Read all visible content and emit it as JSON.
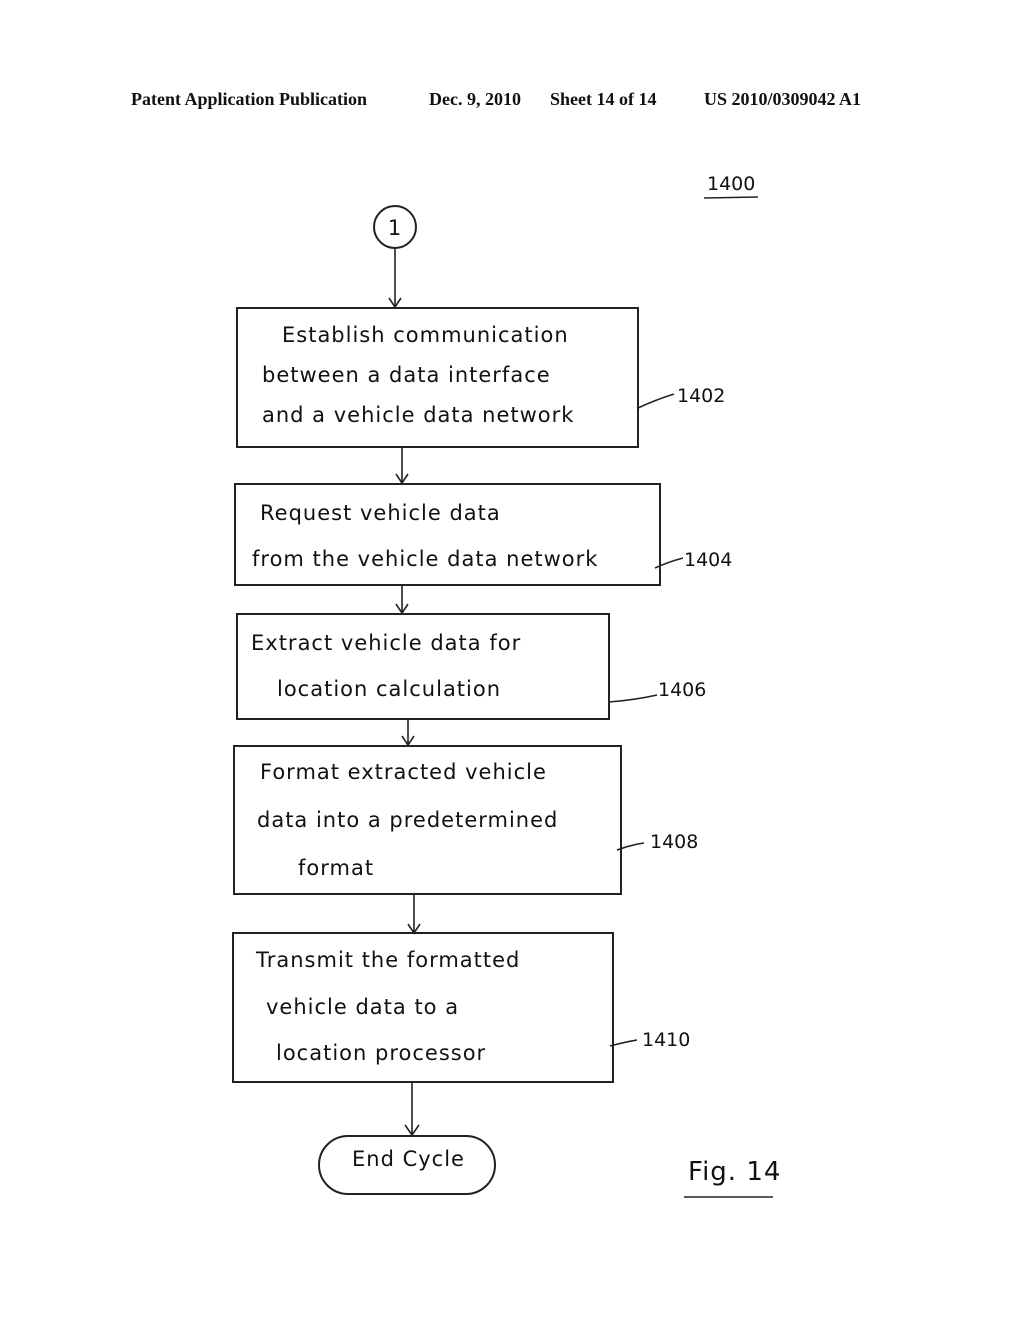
{
  "header": {
    "publication": "Patent Application Publication",
    "date": "Dec. 9, 2010",
    "sheet": "Sheet 14 of 14",
    "number": "US 2010/0309042 A1"
  },
  "figure": {
    "ref": "1400",
    "label": "Fig. 14",
    "connector": "1",
    "steps": [
      {
        "ref": "1402",
        "lines": [
          "Establish communication",
          "between a data interface",
          "and a vehicle data network"
        ]
      },
      {
        "ref": "1404",
        "lines": [
          "Request vehicle data",
          "from the vehicle data network"
        ]
      },
      {
        "ref": "1406",
        "lines": [
          "Extract vehicle data for",
          "location calculation"
        ]
      },
      {
        "ref": "1408",
        "lines": [
          "Format extracted vehicle",
          "data into a predetermined",
          "format"
        ]
      },
      {
        "ref": "1410",
        "lines": [
          "Transmit the formatted",
          "vehicle data to a",
          "location processor"
        ]
      }
    ],
    "end": "End Cycle"
  }
}
